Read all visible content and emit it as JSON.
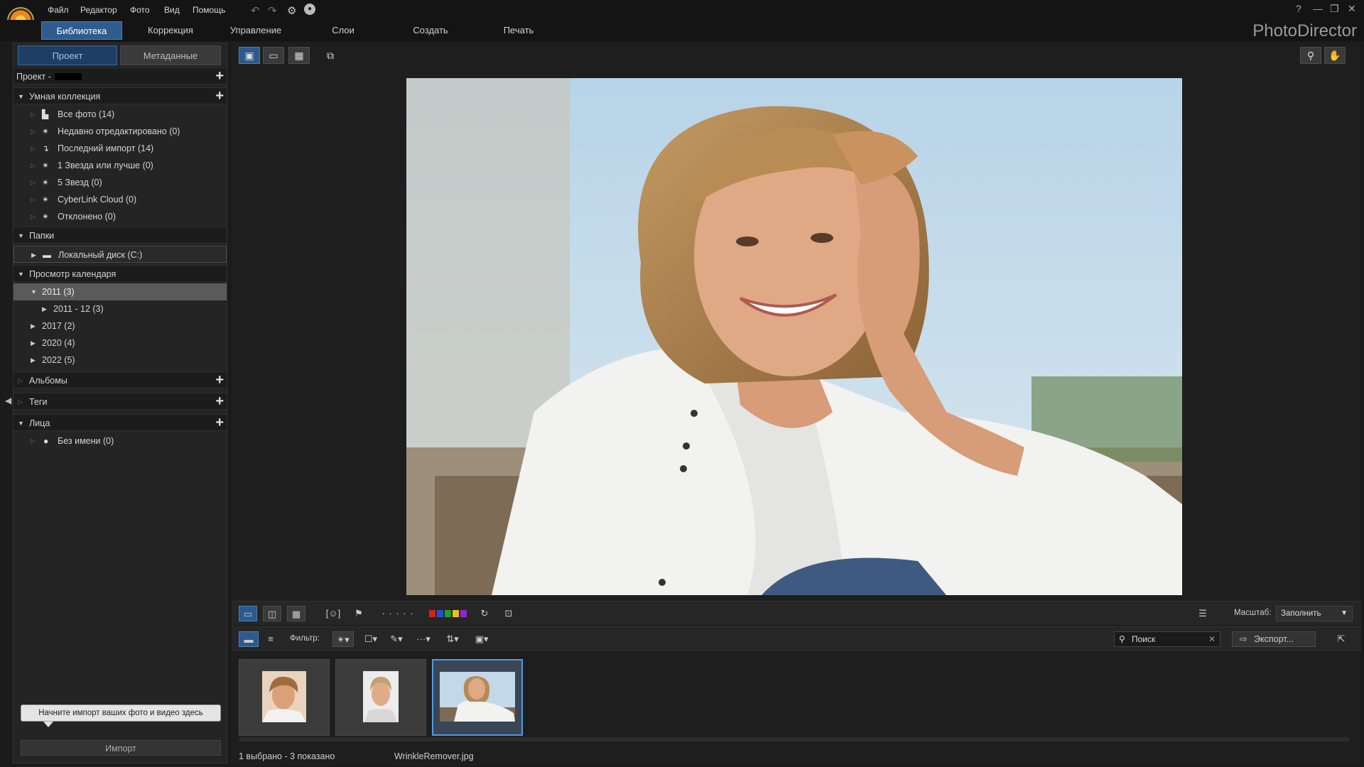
{
  "menu": {
    "items": [
      "Файл",
      "Редактор",
      "Фото",
      "Вид",
      "Помощь"
    ],
    "help_glyph": "?"
  },
  "modules": {
    "tabs": [
      "Библиотека",
      "Коррекция",
      "Управление",
      "Слои",
      "Создать",
      "Печать"
    ],
    "active": "Библиотека",
    "app_name": "PhotoDirector"
  },
  "left_panel": {
    "tab_project": "Проект",
    "tab_metadata": "Метаданные",
    "project_label": "Проект -",
    "smart_collection": {
      "title": "Умная коллекция",
      "items": [
        {
          "label": "Все фото (14)",
          "icon": "photos-icon"
        },
        {
          "label": "Недавно отредактировано (0)",
          "icon": "smart-collection-icon"
        },
        {
          "label": "Последний импорт (14)",
          "icon": "import-icon"
        },
        {
          "label": "1 Звезда или лучше (0)",
          "icon": "smart-collection-icon"
        },
        {
          "label": "5 Звезд (0)",
          "icon": "smart-collection-icon"
        },
        {
          "label": "CyberLink Cloud (0)",
          "icon": "smart-collection-icon"
        },
        {
          "label": "Отклонено (0)",
          "icon": "smart-collection-icon"
        }
      ]
    },
    "folders": {
      "title": "Папки",
      "items": [
        {
          "label": "Локальный диск (C:)",
          "icon": "drive-icon"
        }
      ]
    },
    "calendar": {
      "title": "Просмотр календаря",
      "years": [
        {
          "label": "2011 (3)",
          "expanded": true,
          "selected": true,
          "children": [
            "2011 - 12 (3)"
          ]
        },
        {
          "label": "2017 (2)"
        },
        {
          "label": "2020 (4)"
        },
        {
          "label": "2022 (5)"
        }
      ]
    },
    "albums_title": "Альбомы",
    "tags_title": "Теги",
    "faces": {
      "title": "Лица",
      "items": [
        {
          "label": "Без имени (0)",
          "icon": "person-icon"
        }
      ]
    },
    "tooltip": "Начните импорт ваших фото и видео здесь",
    "import_button": "Импорт"
  },
  "toolbar": {
    "filter_label": "Фильтр:",
    "search_placeholder": "Поиск",
    "export_label": "Экспорт...",
    "zoom_label": "Масштаб:",
    "zoom_value": "Заполнить",
    "rating_dots": "· · · · ·",
    "color_labels": [
      "#d42020",
      "#2a4fcc",
      "#2a9a2a",
      "#e8c020",
      "#8a2ac8"
    ]
  },
  "filmstrip": {
    "count": 3,
    "selected_index": 2
  },
  "status": {
    "selection": "1 выбрано - 3 показано",
    "filename": "WrinkleRemover.jpg"
  }
}
